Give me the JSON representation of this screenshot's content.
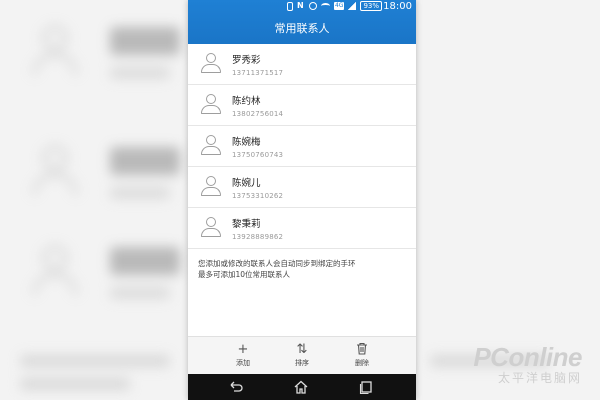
{
  "status_bar": {
    "time": "18:00",
    "battery": "93%",
    "network": "4G"
  },
  "header": {
    "title": "常用联系人"
  },
  "contacts": [
    {
      "name": "罗秀彩",
      "phone": "13711371517"
    },
    {
      "name": "陈约林",
      "phone": "13802756014"
    },
    {
      "name": "陈婉梅",
      "phone": "13750760743"
    },
    {
      "name": "陈婉儿",
      "phone": "13753310262"
    },
    {
      "name": "黎秉莉",
      "phone": "13928889862"
    }
  ],
  "note": {
    "line1": "您添加或修改的联系人会自动同步到绑定的手环",
    "line2": "最多可添加10位常用联系人"
  },
  "toolbar": {
    "add_label": "添加",
    "sort_label": "排序",
    "delete_label": "删除"
  },
  "watermark": {
    "main": "PConline",
    "sub": "太平洋电脑网"
  },
  "colors": {
    "header_bg": "#1f80d4",
    "background": "#f3f3f3"
  }
}
